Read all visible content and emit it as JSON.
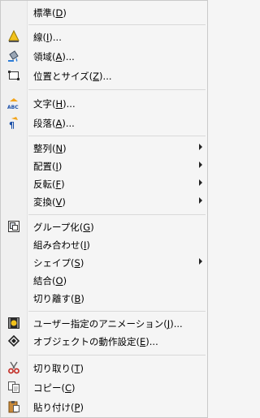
{
  "menu": {
    "items": [
      {
        "label": "標準(D)"
      },
      {
        "label": "線(I)..."
      },
      {
        "label": "領域(A)..."
      },
      {
        "label": "位置とサイズ(Z)..."
      },
      {
        "label": "文字(H)..."
      },
      {
        "label": "段落(A)..."
      },
      {
        "label": "整列(N)"
      },
      {
        "label": "配置(I)"
      },
      {
        "label": "反転(F)"
      },
      {
        "label": "変換(V)"
      },
      {
        "label": "グループ化(G)"
      },
      {
        "label": "組み合わせ(I)"
      },
      {
        "label": "シェイプ(S)"
      },
      {
        "label": "結合(O)"
      },
      {
        "label": "切り離す(B)"
      },
      {
        "label": "ユーザー指定のアニメーション(J)..."
      },
      {
        "label": "オブジェクトの動作設定(E)..."
      },
      {
        "label": "切り取り(T)"
      },
      {
        "label": "コピー(C)"
      },
      {
        "label": "貼り付け(P)"
      }
    ],
    "icons": {
      "line": "line-icon",
      "area": "area-fill-icon",
      "position": "position-size-icon",
      "character": "character-icon",
      "paragraph": "paragraph-icon",
      "group": "group-icon",
      "animation": "animation-icon",
      "interaction": "interaction-icon",
      "cut": "scissors-icon",
      "copy": "copy-icon",
      "paste": "paste-icon"
    }
  }
}
